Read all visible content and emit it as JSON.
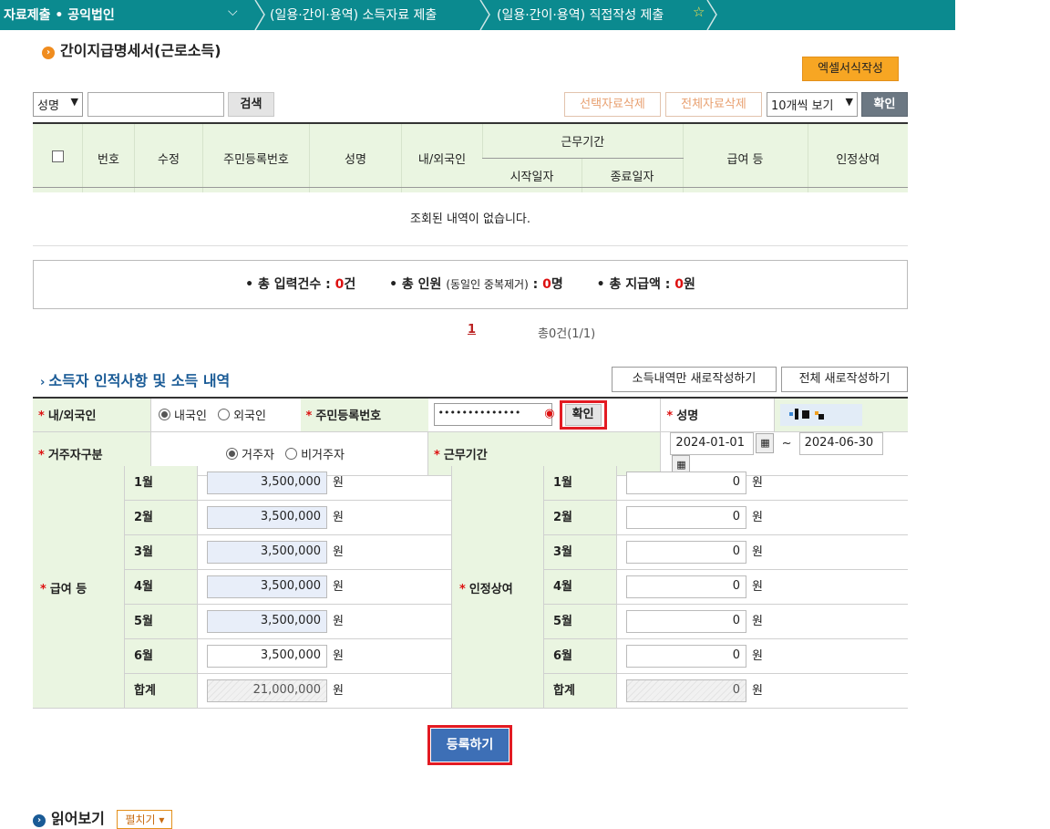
{
  "topbar": {
    "title": "자료제출 • 공익법인",
    "crumb1": "(일용·간이·용역) 소득자료 제출",
    "crumb2": "(일용·간이·용역) 직접작성 제출"
  },
  "section": {
    "title": "간이지급명세서(근로소득)",
    "excel_btn": "엑셀서식작성"
  },
  "search": {
    "field_option": "성명",
    "button": "검색",
    "delete_selected": "선택자료삭제",
    "delete_all": "전체자료삭제",
    "page_size_option": "10개씩 보기",
    "confirm": "확인"
  },
  "list": {
    "headers": {
      "no": "번호",
      "edit": "수정",
      "rrn": "주민등록번호",
      "name": "성명",
      "nationality": "내/외국인",
      "period": "근무기간",
      "start": "시작일자",
      "end": "종료일자",
      "pay": "급여 등",
      "bonus": "인정상여"
    },
    "empty": "조회된 내역이 없습니다."
  },
  "summary": {
    "count_label": "• 총 입력건수 : ",
    "count": "0",
    "count_unit": "건",
    "people_label": "• 총 인원 ",
    "people_note": "(동일인 중복제거)",
    "people_colon": " : ",
    "people": "0",
    "people_unit": "명",
    "amount_label": "• 총 지급액 : ",
    "amount": "0",
    "amount_unit": "원"
  },
  "pager": {
    "current": "1",
    "total": "총0건(1/1)"
  },
  "form": {
    "title": "소득자 인적사항 및 소득 내역",
    "new_income_btn": "소득내역만 새로작성하기",
    "new_all_btn": "전체 새로작성하기",
    "nationality_label": "내/외국인",
    "domestic": "내국인",
    "foreign": "외국인",
    "rrn_label": "주민등록번호",
    "rrn_value": "••••••••••••••",
    "rrn_confirm": "확인",
    "name_label": "성명",
    "residence_label": "거주자구분",
    "resident": "거주자",
    "nonresident": "비거주자",
    "period_label": "근무기간",
    "start_date": "2024-01-01",
    "tilde": "~",
    "end_date": "2024-06-30",
    "pay_label": "급여 등",
    "bonus_label": "인정상여",
    "months": [
      "1월",
      "2월",
      "3월",
      "4월",
      "5월",
      "6월"
    ],
    "total_label": "합계",
    "pay_values": [
      "3,500,000",
      "3,500,000",
      "3,500,000",
      "3,500,000",
      "3,500,000",
      "3,500,000"
    ],
    "pay_total": "21,000,000",
    "bonus_values": [
      "0",
      "0",
      "0",
      "0",
      "0",
      "0"
    ],
    "bonus_total": "0",
    "unit": "원",
    "submit": "등록하기"
  },
  "next_section": {
    "title": "읽어보기",
    "btn": "펼치기"
  }
}
